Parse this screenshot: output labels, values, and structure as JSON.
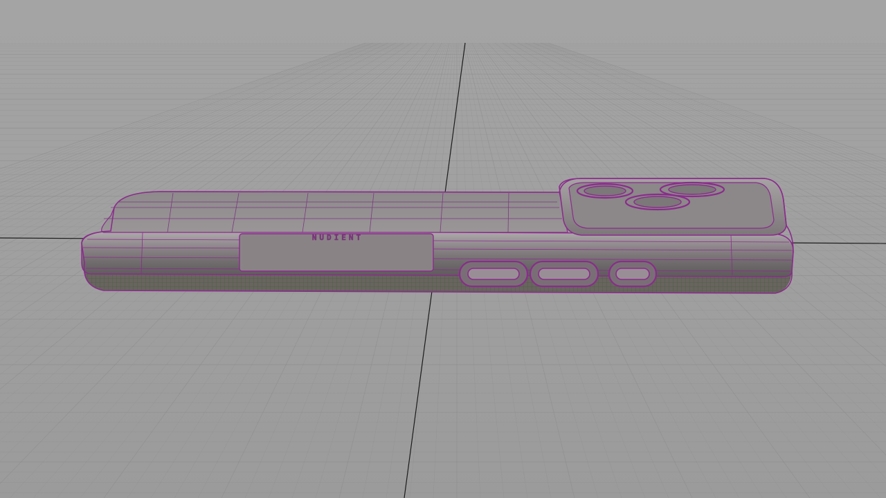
{
  "app": {
    "window_title": "",
    "view": "perspective"
  },
  "scene": {
    "object": "phone-case-model",
    "display_mode": "wireframe-on-shaded",
    "wire_color": "#8a2c8c",
    "surface_color": "#8f8a8c",
    "background_color": "#9d9d9d",
    "grid_color": "#888888",
    "axis_color": "#1a1a1a"
  },
  "model": {
    "embossed_text": "NUDIENT",
    "camera_lenses": 3,
    "side_button_cutouts": 3
  }
}
